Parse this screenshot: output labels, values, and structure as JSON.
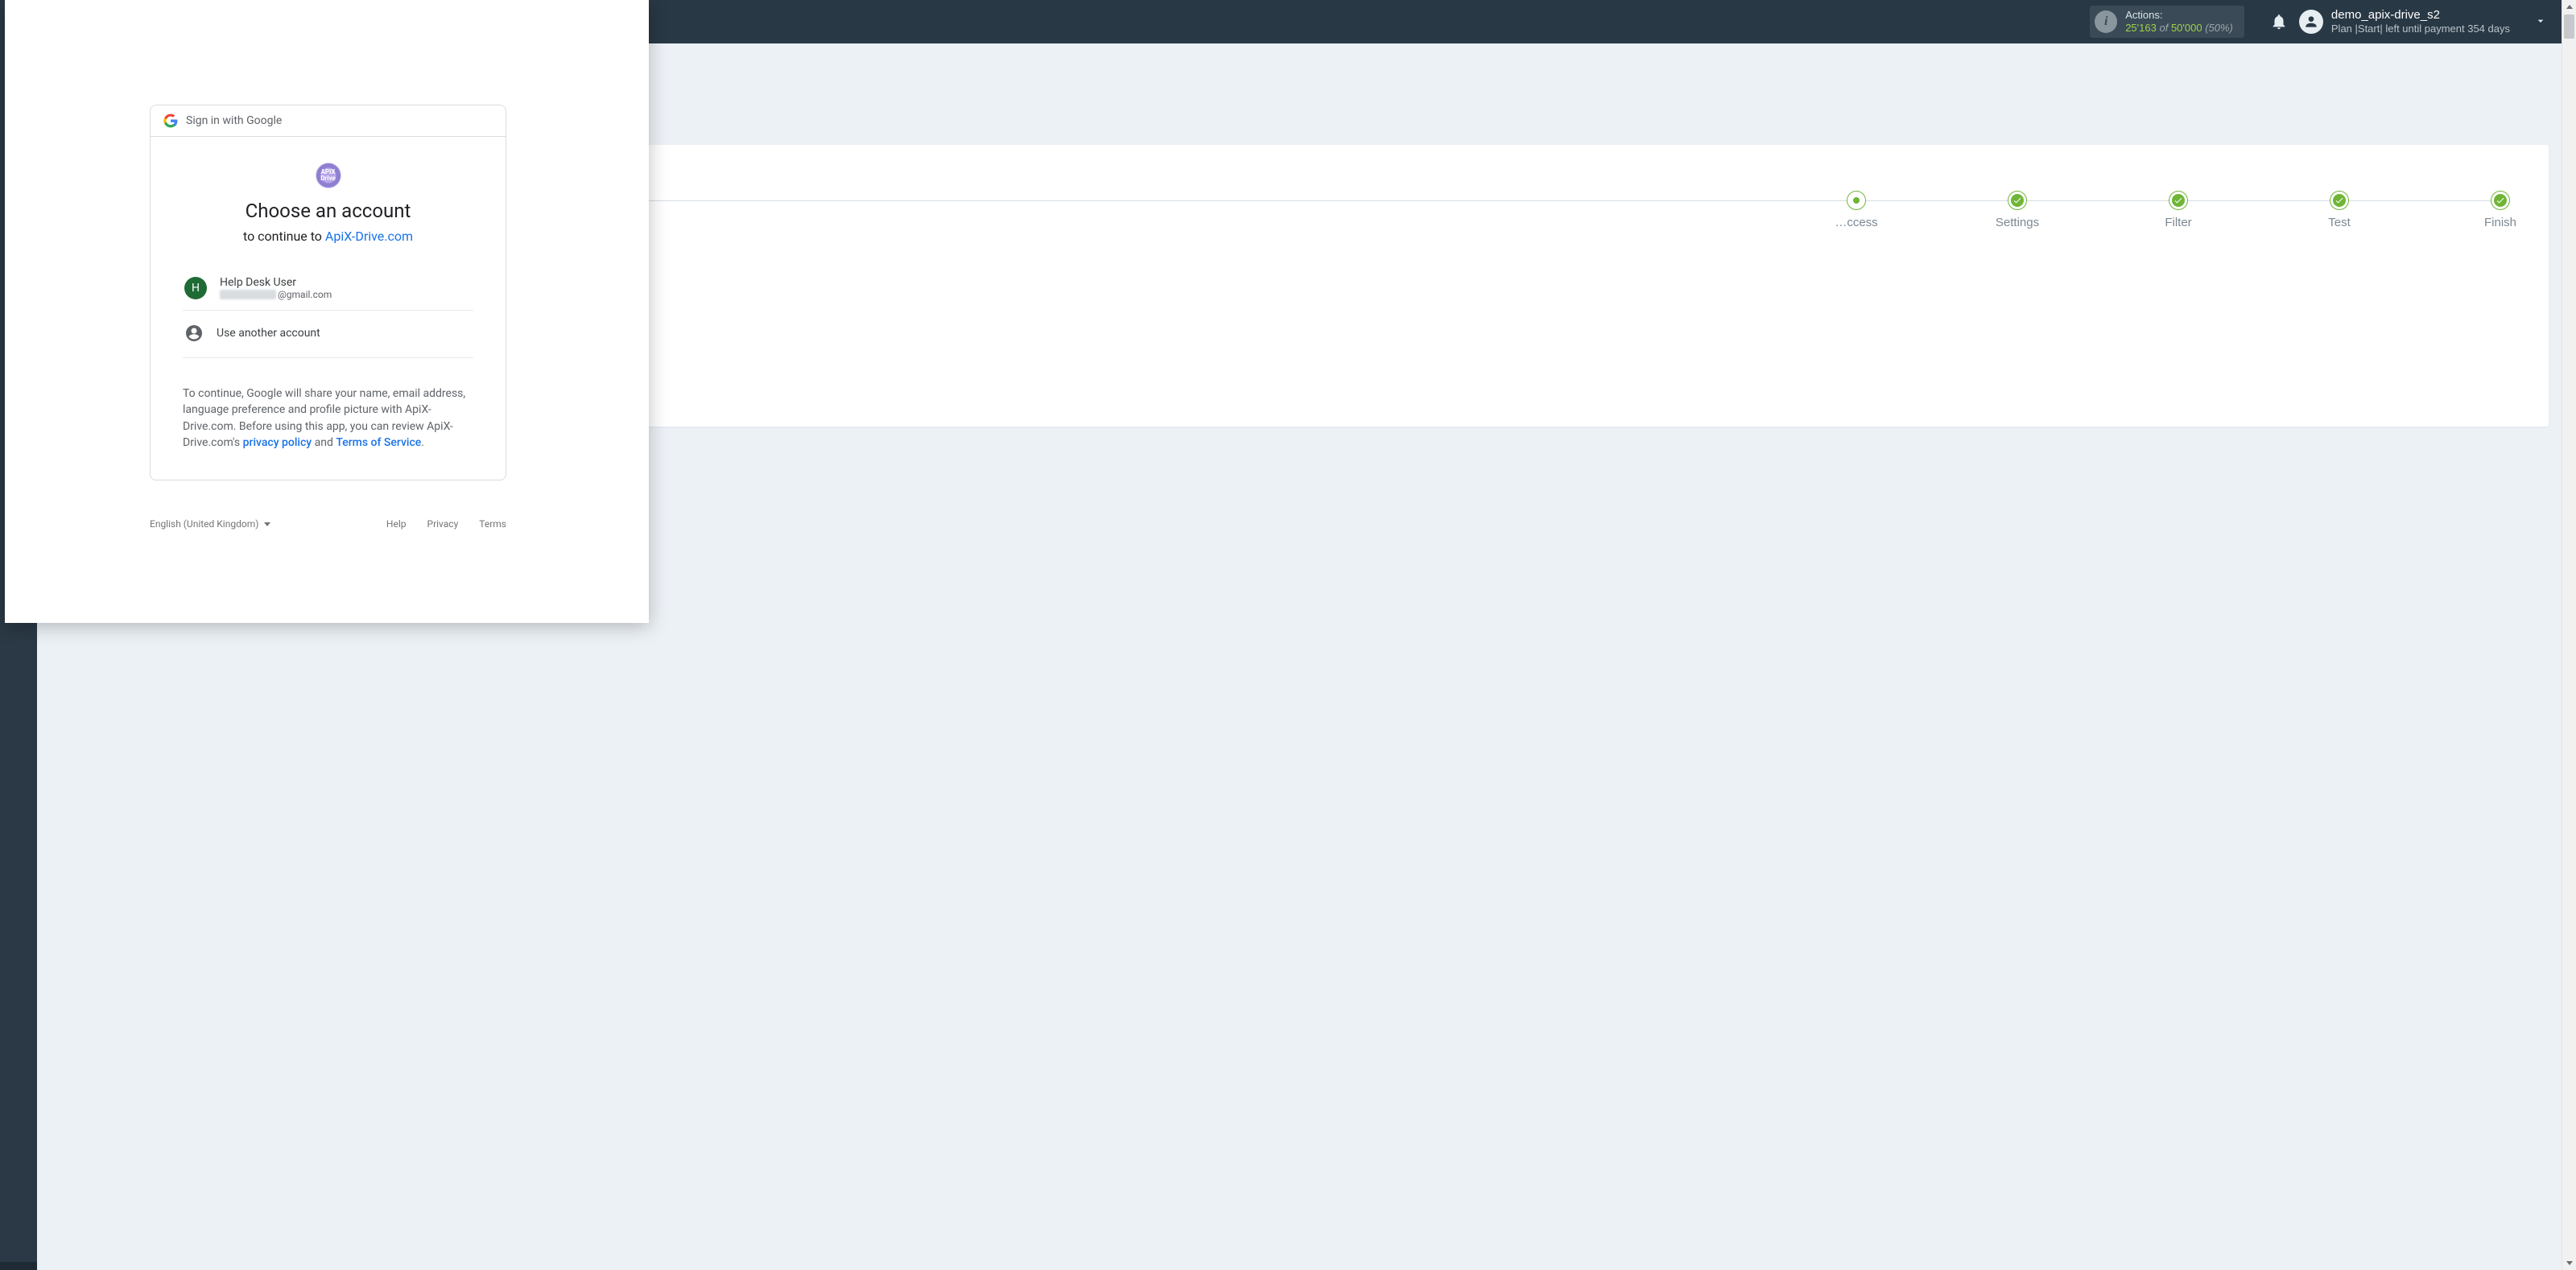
{
  "header": {
    "actions": {
      "label": "Actions:",
      "used": "25'163",
      "of": "of",
      "total": "50'000",
      "percent": "(50%)"
    },
    "user": {
      "name": "demo_apix-drive_s2",
      "plan_line": "Plan |Start| left until payment 354 days"
    }
  },
  "steps": {
    "access": "…ccess",
    "settings": "Settings",
    "filter": "Filter",
    "test": "Test",
    "finish": "Finish"
  },
  "google": {
    "sign_in_with": "Sign in with Google",
    "app_logo_text": "APIX\nDrive",
    "title": "Choose an account",
    "continue_prefix": "to continue to ",
    "continue_app": "ApiX-Drive.com",
    "account": {
      "initial": "H",
      "name": "Help Desk User",
      "email_suffix": "@gmail.com"
    },
    "use_another": "Use another account",
    "disclosure_1": "To continue, Google will share your name, email address, language preference and profile picture with ApiX-Drive.com. Before using this app, you can review ApiX-Drive.com's ",
    "privacy": "privacy policy",
    "and": " and ",
    "tos": "Terms of Service",
    "period": ".",
    "footer": {
      "language": "English (United Kingdom)",
      "help": "Help",
      "privacy": "Privacy",
      "terms": "Terms"
    }
  }
}
